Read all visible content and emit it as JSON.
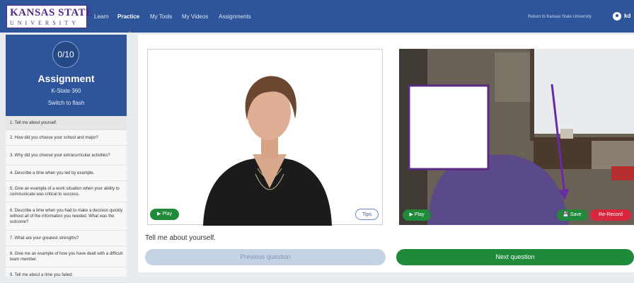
{
  "brand": {
    "line1": "KANSAS STATE",
    "line2": "UNIVERSITY"
  },
  "nav": [
    "Learn",
    "Practice",
    "My Tools",
    "My Videos",
    "Assignments"
  ],
  "nav_active": "Practice",
  "header": {
    "return_link": "Return to Kansas State University",
    "user": "kd"
  },
  "sidebar": {
    "score": "0/10",
    "title": "Assignment",
    "subtitle": "K-State 360",
    "switch_link": "Switch to flash",
    "questions": [
      "1. Tell me about yourself.",
      "2. How did you choose your school and major?",
      "3. Why did you choose your extracurricular activities?",
      "4. Describe a time when you led by example.",
      "5. Give an example of a work situation when your ability to communicate was critical to success.",
      "6. Describe a time when you had to make a decision quickly without all of the information you needed. What was the outcome?",
      "7. What are your greatest strengths?",
      "8. Give me an example of how you have dealt with a difficult team member.",
      "9. Tell me about a time you failed."
    ]
  },
  "interviewer_video": {
    "play_label": "▶ Play",
    "tips_label": "Tips"
  },
  "user_video": {
    "play_label": "▶ Play",
    "save_label": "💾 Save",
    "rerecord_label": "Re-Record"
  },
  "current_question": "Tell me about yourself.",
  "navigation": {
    "prev_label": "Previous question",
    "next_label": "Next question"
  },
  "colors": {
    "header_blue": "#2e5599",
    "brand_purple": "#512888",
    "green": "#1f8a3a",
    "red": "#d7263d",
    "disabled": "#c4d2e4"
  }
}
